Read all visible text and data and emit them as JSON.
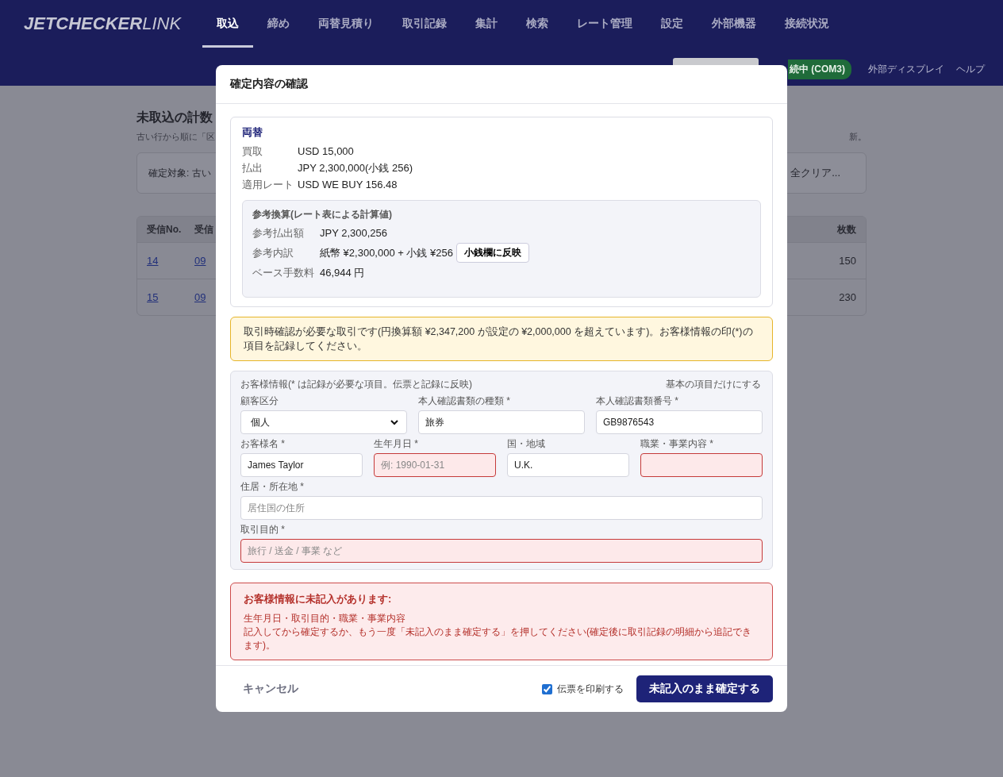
{
  "header": {
    "logo_bold": "JETCHECKER",
    "logo_light": "LINK",
    "tabs": [
      {
        "label": "取込",
        "selected": true
      },
      {
        "label": "締め",
        "selected": false
      },
      {
        "label": "両替見積り",
        "selected": false
      },
      {
        "label": "取引記録",
        "selected": false
      },
      {
        "label": "集計",
        "selected": false
      },
      {
        "label": "検索",
        "selected": false
      },
      {
        "label": "レート管理",
        "selected": false
      },
      {
        "label": "設定",
        "selected": false
      },
      {
        "label": "外部機器",
        "selected": false
      },
      {
        "label": "接続状況",
        "selected": false
      }
    ],
    "status_badge": "続中 (COM3)",
    "links": [
      "外部ディスプレイ",
      "ヘルプ"
    ]
  },
  "background": {
    "title": "未取込の計数",
    "subtitle_left": "古い行から順に「区",
    "subtitle_right": "新。",
    "target_label": "確定対象: 古い",
    "clear_button": "全クリア...",
    "table": {
      "columns_left": [
        "受信No.",
        "受信"
      ],
      "column_right": "枚数",
      "rows": [
        {
          "no": "14",
          "column_2": "09",
          "count": "150"
        },
        {
          "no": "15",
          "column_2": "09",
          "count": "230"
        }
      ]
    }
  },
  "dialog": {
    "title": "確定内容の確認",
    "summary": {
      "heading": "両替",
      "rows": [
        {
          "label": "買取",
          "value": "USD 15,000"
        },
        {
          "label": "払出",
          "value": "JPY 2,300,000(小銭 256)"
        },
        {
          "label": "適用レート",
          "value": "USD WE BUY 156.48"
        }
      ],
      "reference": {
        "heading": "参考換算(レート表による計算値)",
        "rows": [
          {
            "label": "参考払出額",
            "value": "JPY 2,300,256"
          },
          {
            "label": "参考内訳",
            "value": "紙幣 ¥2,300,000 + 小銭 ¥256",
            "button": "小銭欄に反映"
          },
          {
            "label": "ベース手数料",
            "value": "46,944 円"
          }
        ]
      }
    },
    "warning": "取引時確認が必要な取引です(円換算額 ¥2,347,200 が設定の ¥2,000,000 を超えています)。お客様情報の印(*)の項目を記録してください。",
    "customer": {
      "heading": "お客様情報(* は記録が必要な項目。伝票と記録に反映)",
      "toggle_link": "基本の項目だけにする",
      "rows": [
        [
          {
            "kind": "select",
            "label": "顧客区分",
            "value": "個人",
            "error": false
          },
          {
            "kind": "input",
            "label": "本人確認書類の種類 *",
            "value": "旅券",
            "error": false
          },
          {
            "kind": "input",
            "label": "本人確認書類番号 *",
            "value": "GB9876543",
            "error": false
          }
        ],
        [
          {
            "kind": "input",
            "label": "お客様名 *",
            "value": "James Taylor",
            "error": false
          },
          {
            "kind": "input",
            "label": "生年月日 *",
            "placeholder": "例: 1990-01-31",
            "error": true
          },
          {
            "kind": "input",
            "label": "国・地域",
            "value": "U.K.",
            "error": false
          },
          {
            "kind": "input",
            "label": "職業・事業内容 *",
            "error": true
          }
        ],
        [
          {
            "kind": "input",
            "label": "住居・所在地 *",
            "placeholder": "居住国の住所",
            "error": false
          }
        ],
        [
          {
            "kind": "input",
            "label": "取引目的 *",
            "placeholder": "旅行 / 送金 / 事業 など",
            "error": true
          }
        ]
      ]
    },
    "error_box": {
      "title": "お客様情報に未記入があります:",
      "lines": [
        "生年月日・取引目的・職業・事業内容",
        "記入してから確定するか、もう一度「未記入のまま確定する」を押してください(確定後に取引記録の明細から追記できます)。"
      ]
    },
    "footer": {
      "cancel": "キャンセル",
      "print": {
        "label": "伝票を印刷する",
        "checked": true
      },
      "confirm": "未記入のまま確定する"
    }
  }
}
